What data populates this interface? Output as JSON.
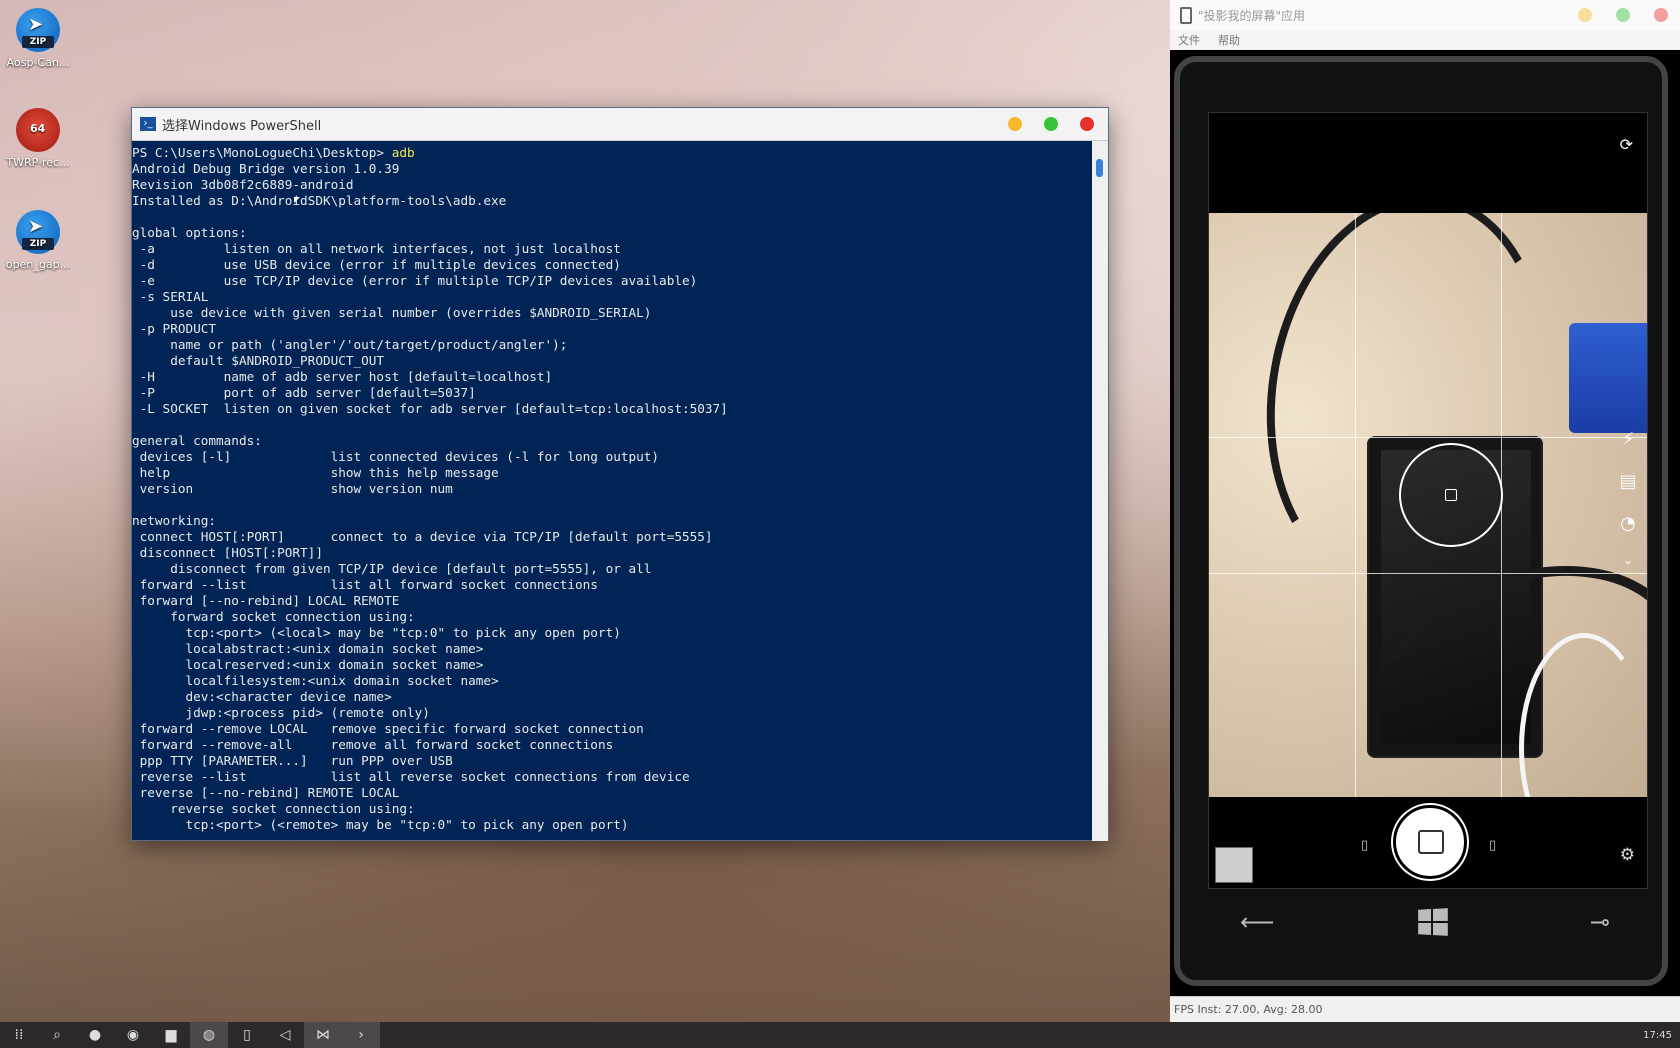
{
  "desktop": {
    "icons": [
      {
        "label": "Aosp-Can...",
        "badge": "ZIP"
      },
      {
        "label": "TWRP-rec...",
        "badge": "64"
      },
      {
        "label": "open_gap...",
        "badge": "ZIP"
      }
    ]
  },
  "powershell": {
    "title": "选择Windows PowerShell",
    "prompt": "PS C:\\Users\\MonoLogueChi\\Desktop> ",
    "command": "adb",
    "output": "Android Debug Bridge version 1.0.39\nRevision 3db08f2c6889-android\nInstalled as D:\\AndroidSDK\\platform-tools\\adb.exe\n\nglobal options:\n -a         listen on all network interfaces, not just localhost\n -d         use USB device (error if multiple devices connected)\n -e         use TCP/IP device (error if multiple TCP/IP devices available)\n -s SERIAL\n     use device with given serial number (overrides $ANDROID_SERIAL)\n -p PRODUCT\n     name or path ('angler'/'out/target/product/angler');\n     default $ANDROID_PRODUCT_OUT\n -H         name of adb server host [default=localhost]\n -P         port of adb server [default=5037]\n -L SOCKET  listen on given socket for adb server [default=tcp:localhost:5037]\n\ngeneral commands:\n devices [-l]             list connected devices (-l for long output)\n help                     show this help message\n version                  show version num\n\nnetworking:\n connect HOST[:PORT]      connect to a device via TCP/IP [default port=5555]\n disconnect [HOST[:PORT]]\n     disconnect from given TCP/IP device [default port=5555], or all\n forward --list           list all forward socket connections\n forward [--no-rebind] LOCAL REMOTE\n     forward socket connection using:\n       tcp:<port> (<local> may be \"tcp:0\" to pick any open port)\n       localabstract:<unix domain socket name>\n       localreserved:<unix domain socket name>\n       localfilesystem:<unix domain socket name>\n       dev:<character device name>\n       jdwp:<process pid> (remote only)\n forward --remove LOCAL   remove specific forward socket connection\n forward --remove-all     remove all forward socket connections\n ppp TTY [PARAMETER...]   run PPP over USB\n reverse --list           list all reverse socket connections from device\n reverse [--no-rebind] REMOTE LOCAL\n     reverse socket connection using:\n       tcp:<port> (<remote> may be \"tcp:0\" to pick any open port)"
  },
  "projector": {
    "title": "\"投影我的屏幕\"应用",
    "menu": [
      "文件",
      "帮助"
    ],
    "status": "FPS Inst: 27.00, Avg: 28.00"
  },
  "taskbar": {
    "clock": "17:45",
    "items": [
      "start-icon",
      "search-icon",
      "qq-icon",
      "chrome-icon",
      "explorer-icon",
      "browser-icon",
      "phone-icon",
      "vs-icon",
      "visualstudio-icon",
      "powershell-icon"
    ]
  },
  "colors": {
    "ps_background": "#012456",
    "ps_text": "#e9e9e9",
    "ps_command": "#f5e94f"
  }
}
